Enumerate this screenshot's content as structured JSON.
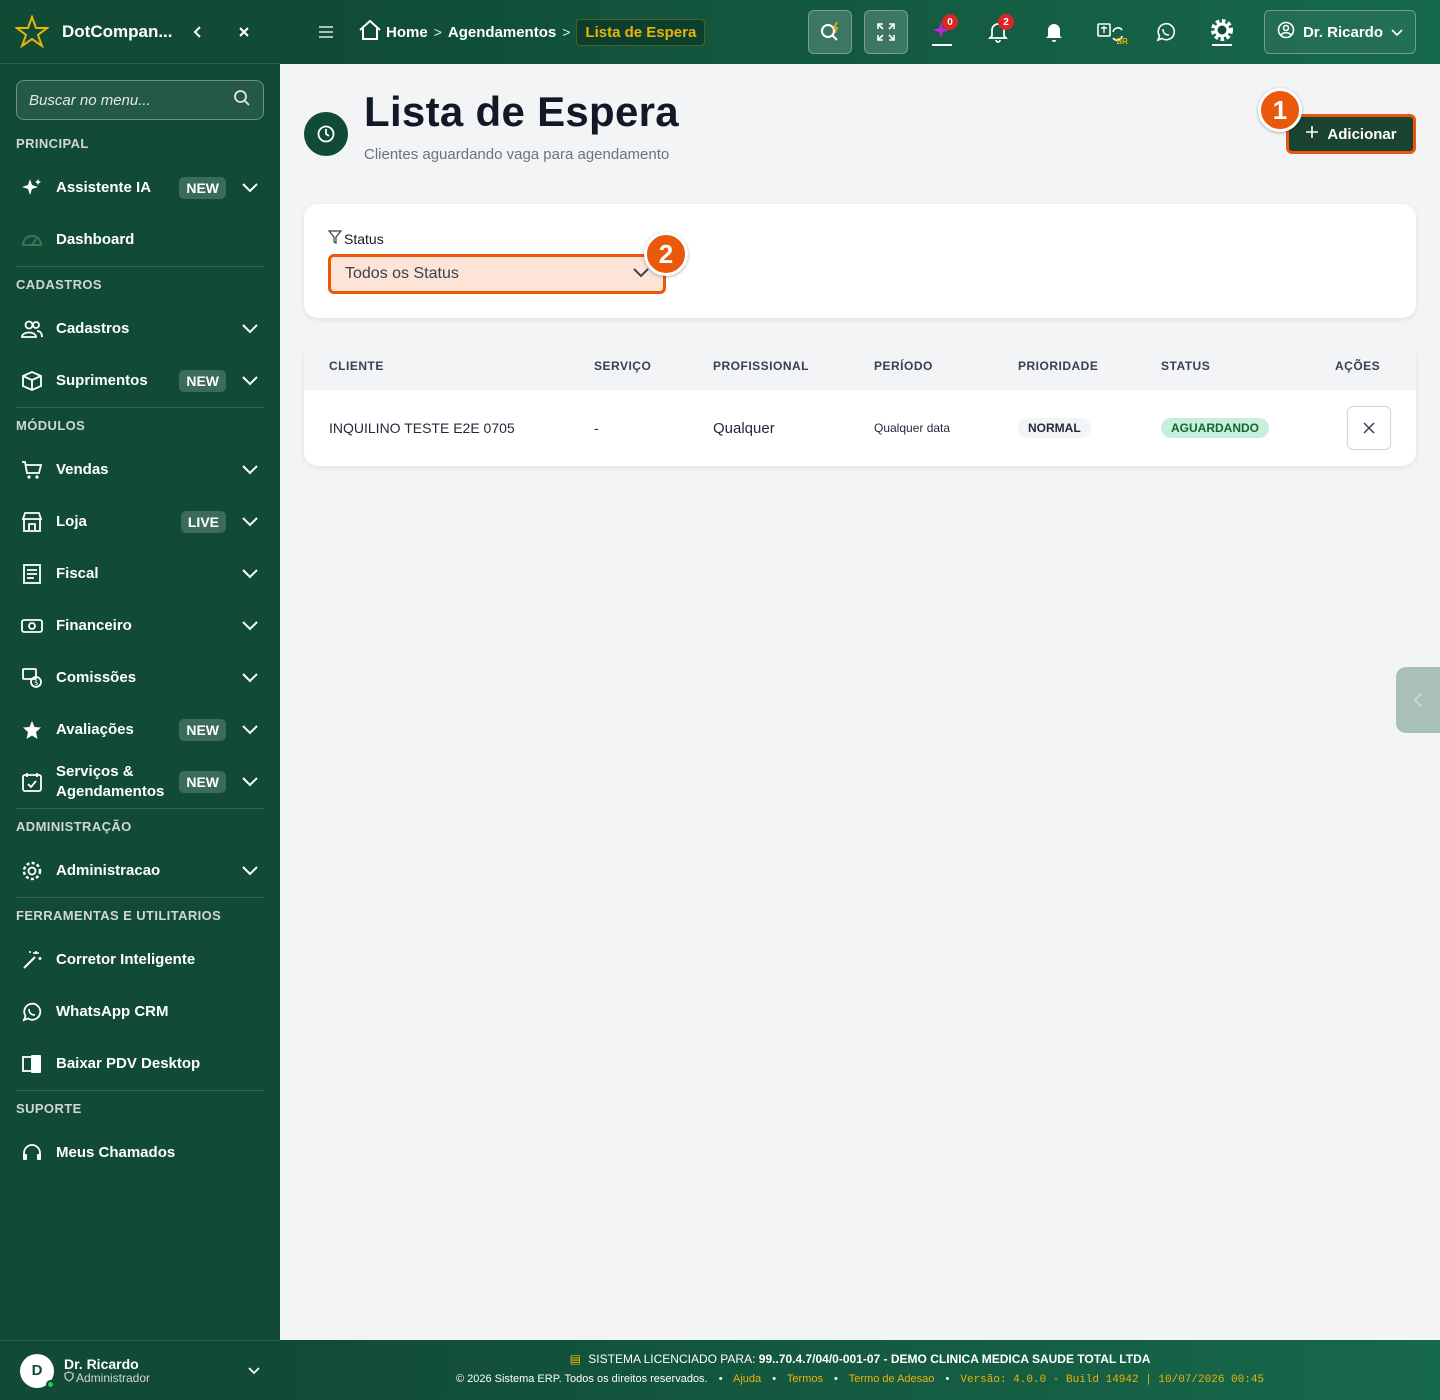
{
  "sidebar": {
    "brand": "DotCompan...",
    "search_placeholder": "Buscar no menu...",
    "sections": {
      "principal": "PRINCIPAL",
      "cadastros": "CADASTROS",
      "modulos": "MÓDULOS",
      "administracao": "ADMINISTRAÇÃO",
      "ferramentas": "FERRAMENTAS E UTILITARIOS",
      "suporte": "SUPORTE"
    },
    "items": {
      "assistente": "Assistente IA",
      "dashboard": "Dashboard",
      "cadastros": "Cadastros",
      "suprimentos": "Suprimentos",
      "vendas": "Vendas",
      "loja": "Loja",
      "fiscal": "Fiscal",
      "financeiro": "Financeiro",
      "comissoes": "Comissões",
      "avaliacoes": "Avaliações",
      "servicos": "Serviços & Agendamentos",
      "admin": "Administracao",
      "corretor": "Corretor Inteligente",
      "whatsapp": "WhatsApp CRM",
      "pdv": "Baixar PDV Desktop",
      "chamados": "Meus Chamados"
    },
    "badges": {
      "new": "NEW",
      "live": "LIVE"
    },
    "user": {
      "initial": "D",
      "name": "Dr. Ricardo",
      "role": "Administrador"
    }
  },
  "topbar": {
    "breadcrumb": {
      "home": "Home",
      "parent": "Agendamentos",
      "current": "Lista de Espera"
    },
    "ai_count": "0",
    "notif_count": "2",
    "lang_code": "BR",
    "user_name": "Dr. Ricardo"
  },
  "page": {
    "title": "Lista de Espera",
    "subtitle": "Clientes aguardando vaga para agendamento",
    "add_label": "Adicionar",
    "markers": [
      "1",
      "2"
    ]
  },
  "filter": {
    "label": "Status",
    "selected": "Todos os Status"
  },
  "table": {
    "headers": [
      "CLIENTE",
      "SERVIÇO",
      "PROFISSIONAL",
      "PERÍODO",
      "PRIORIDADE",
      "STATUS",
      "AÇÕES"
    ],
    "rows": [
      {
        "cliente": "INQUILINO TESTE E2E 0705",
        "servico": "-",
        "profissional": "Qualquer",
        "periodo": "Qualquer data",
        "prioridade": "NORMAL",
        "status": "AGUARDANDO"
      }
    ]
  },
  "footer": {
    "license_prefix": "SISTEMA LICENCIADO PARA:",
    "license_value": "99..70.4.7/04/0-001-07 - DEMO CLINICA MEDICA SAUDE TOTAL LTDA",
    "copyright": "© 2026 Sistema ERP. Todos os direitos reservados.",
    "links": [
      "Ajuda",
      "Termos",
      "Termo de Adesao"
    ],
    "version": "Versão: 4.0.0 - Build 14942 | 10/07/2026 00:45"
  },
  "colors": {
    "sidebar": "#114b36",
    "accent": "#ea580c",
    "highlight": "#eab308"
  }
}
